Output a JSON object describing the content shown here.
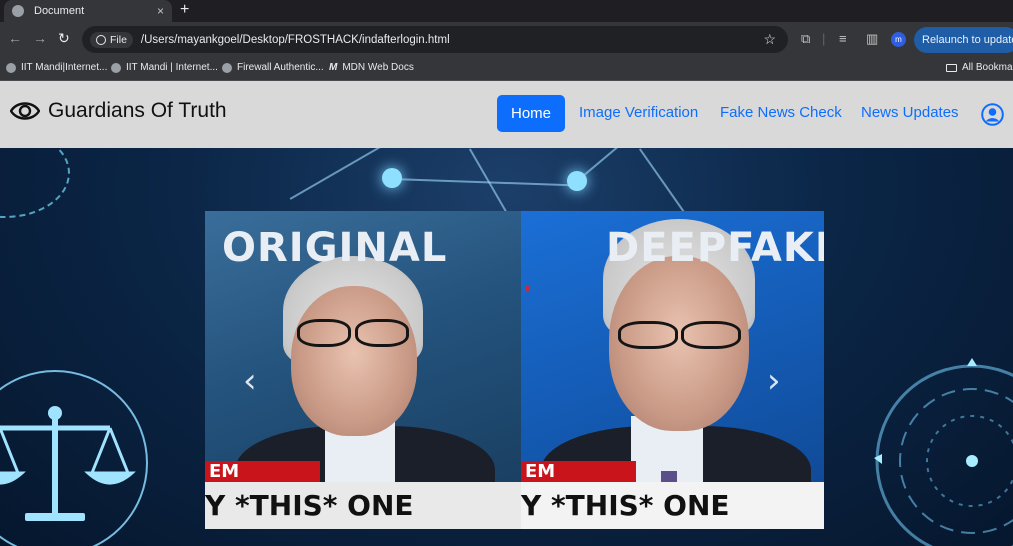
{
  "browser": {
    "tab_title": "Document",
    "tab_close": "×",
    "new_tab": "+",
    "omnibox_chip": "File",
    "url": "/Users/mayankgoel/Desktop/FROSTHACK/indafterlogin.html",
    "profile_initial": "m",
    "relaunch_label": "Relaunch to update",
    "bookmarks": [
      "IIT Mandi|Internet...",
      "IIT Mandi | Internet...",
      "Firewall Authentic...",
      "MDN Web Docs"
    ],
    "all_bookmarks": "All Bookmarks"
  },
  "navbar": {
    "brand": "Guardians Of Truth",
    "links": [
      "Home",
      "Image Verification",
      "Fake News Check",
      "News Updates"
    ],
    "active_link": "Home",
    "accent": "#0d6efd"
  },
  "carousel": {
    "left_label": "ORIGINAL",
    "right_label": "DEEPFAKE",
    "lower_third_tag": "EM HONEST",
    "lower_third_text": "Y *THIS* ONE",
    "prev_icon": "chevron-left-icon",
    "next_icon": "chevron-right-icon"
  }
}
